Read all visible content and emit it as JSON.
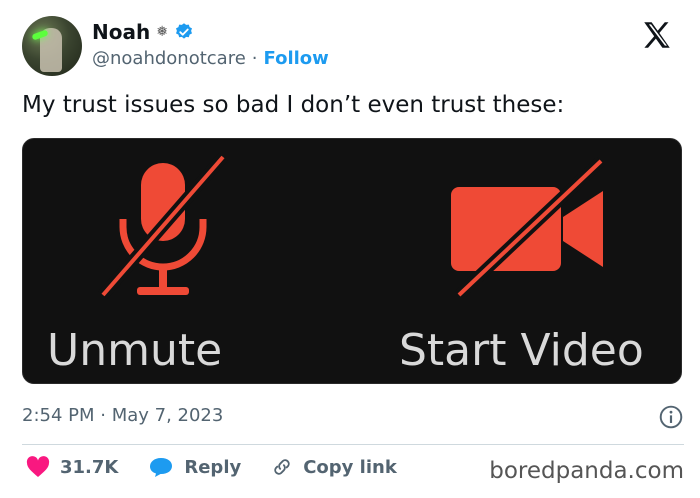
{
  "user": {
    "name": "Noah",
    "name_symbol": "❅",
    "handle": "@noahdonotcare",
    "separator": "·",
    "follow_label": "Follow"
  },
  "tweet": {
    "text": "My trust issues so bad I don’t even trust these:",
    "media": {
      "left_label": "Unmute",
      "right_label": "Start Video",
      "icon_color": "#ef4a36"
    },
    "timestamp": "2:54 PM · May 7, 2023"
  },
  "actions": {
    "likes": "31.7K",
    "reply_label": "Reply",
    "copy_link_label": "Copy link"
  },
  "watermark": "boredpanda.com",
  "colors": {
    "accent": "#1d9bf0",
    "like": "#f91880",
    "text": "#0f1419",
    "muted": "#536471"
  }
}
